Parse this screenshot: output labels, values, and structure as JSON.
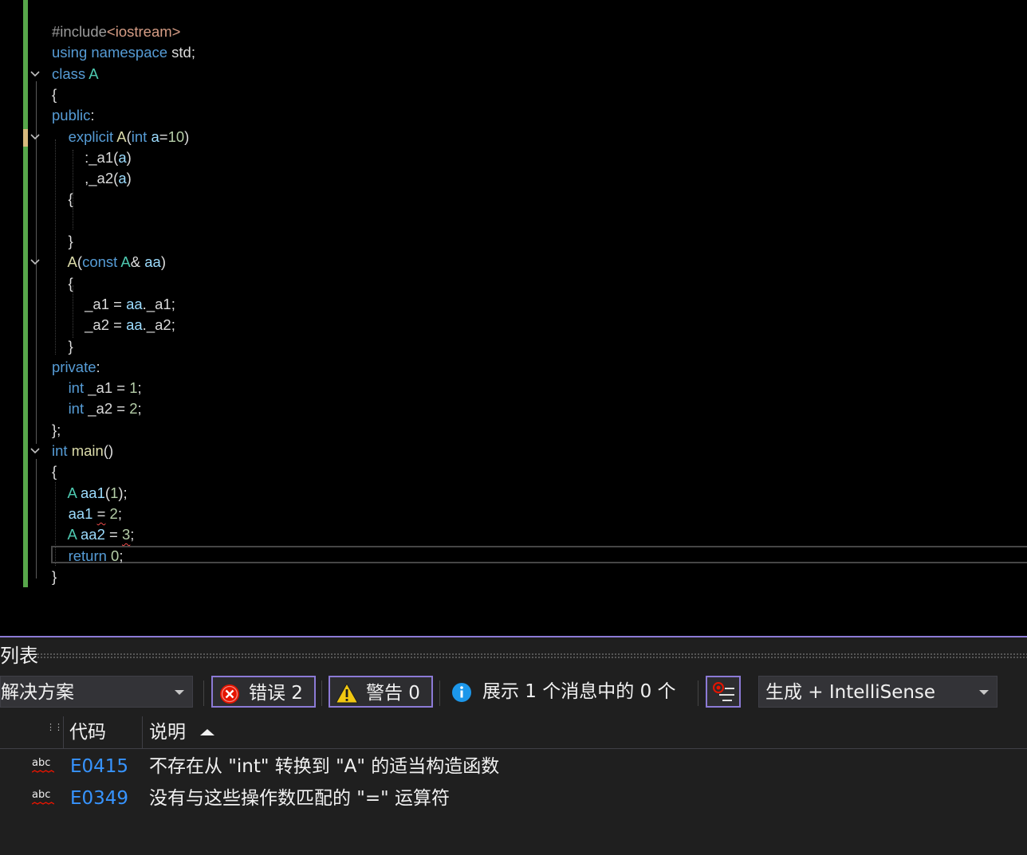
{
  "editor": {
    "lines": [
      [
        [
          "pp",
          "#include"
        ],
        [
          "str",
          "<iostream>"
        ]
      ],
      [
        [
          "kw",
          "using"
        ],
        [
          "t",
          " "
        ],
        [
          "kw",
          "namespace"
        ],
        [
          "t",
          " std;"
        ]
      ],
      [
        [
          "kw",
          "class"
        ],
        [
          "t",
          " "
        ],
        [
          "ty",
          "A"
        ]
      ],
      [
        [
          "t",
          "{"
        ]
      ],
      [
        [
          "kw",
          "public"
        ],
        [
          "t",
          ":"
        ]
      ],
      [
        [
          "t",
          "    "
        ],
        [
          "kw",
          "explicit"
        ],
        [
          "t",
          " "
        ],
        [
          "fn",
          "A"
        ],
        [
          "t",
          "("
        ],
        [
          "kw",
          "int"
        ],
        [
          "t",
          " "
        ],
        [
          "var",
          "a"
        ],
        [
          "t",
          "="
        ],
        [
          "num",
          "10"
        ],
        [
          "t",
          ")"
        ]
      ],
      [
        [
          "t",
          "        :"
        ],
        [
          "mem",
          "_a1"
        ],
        [
          "t",
          "("
        ],
        [
          "var",
          "a"
        ],
        [
          "t",
          ")"
        ]
      ],
      [
        [
          "t",
          "        ,"
        ],
        [
          "mem",
          "_a2"
        ],
        [
          "t",
          "("
        ],
        [
          "var",
          "a"
        ],
        [
          "t",
          ")"
        ]
      ],
      [
        [
          "t",
          "    {"
        ]
      ],
      [
        [
          "t",
          ""
        ]
      ],
      [
        [
          "t",
          "    }"
        ]
      ],
      [
        [
          "t",
          "    "
        ],
        [
          "fn",
          "A"
        ],
        [
          "t",
          "("
        ],
        [
          "kw",
          "const"
        ],
        [
          "t",
          " "
        ],
        [
          "ty",
          "A"
        ],
        [
          "t",
          "& "
        ],
        [
          "var",
          "aa"
        ],
        [
          "t",
          ")"
        ]
      ],
      [
        [
          "t",
          "    {"
        ]
      ],
      [
        [
          "t",
          "        "
        ],
        [
          "mem",
          "_a1"
        ],
        [
          "t",
          " = "
        ],
        [
          "var",
          "aa"
        ],
        [
          "t",
          "."
        ],
        [
          "mem",
          "_a1"
        ],
        [
          "t",
          ";"
        ]
      ],
      [
        [
          "t",
          "        "
        ],
        [
          "mem",
          "_a2"
        ],
        [
          "t",
          " = "
        ],
        [
          "var",
          "aa"
        ],
        [
          "t",
          "."
        ],
        [
          "mem",
          "_a2"
        ],
        [
          "t",
          ";"
        ]
      ],
      [
        [
          "t",
          "    }"
        ]
      ],
      [
        [
          "kw",
          "private"
        ],
        [
          "t",
          ":"
        ]
      ],
      [
        [
          "t",
          "    "
        ],
        [
          "kw",
          "int"
        ],
        [
          "t",
          " "
        ],
        [
          "mem",
          "_a1"
        ],
        [
          "t",
          " = "
        ],
        [
          "num",
          "1"
        ],
        [
          "t",
          ";"
        ]
      ],
      [
        [
          "t",
          "    "
        ],
        [
          "kw",
          "int"
        ],
        [
          "t",
          " "
        ],
        [
          "mem",
          "_a2"
        ],
        [
          "t",
          " = "
        ],
        [
          "num",
          "2"
        ],
        [
          "t",
          ";"
        ]
      ],
      [
        [
          "t",
          "};"
        ]
      ],
      [
        [
          "kw",
          "int"
        ],
        [
          "t",
          " "
        ],
        [
          "fn",
          "main"
        ],
        [
          "t",
          "()"
        ]
      ],
      [
        [
          "t",
          "{"
        ]
      ],
      [
        [
          "t",
          "    "
        ],
        [
          "ty",
          "A"
        ],
        [
          "t",
          " "
        ],
        [
          "var",
          "aa1"
        ],
        [
          "t",
          "("
        ],
        [
          "num",
          "1"
        ],
        [
          "t",
          ");"
        ]
      ],
      [
        [
          "t",
          "    "
        ],
        [
          "var",
          "aa1"
        ],
        [
          "t",
          " "
        ],
        [
          "sq",
          "="
        ],
        [
          "t",
          " "
        ],
        [
          "num",
          "2"
        ],
        [
          "t",
          ";"
        ]
      ],
      [
        [
          "t",
          "    "
        ],
        [
          "ty",
          "A"
        ],
        [
          "t",
          " "
        ],
        [
          "var",
          "aa2"
        ],
        [
          "t",
          " = "
        ],
        [
          "sqn",
          "3"
        ],
        [
          "t",
          ";"
        ]
      ],
      [
        [
          "t",
          "    "
        ],
        [
          "kw",
          "return"
        ],
        [
          "t",
          " "
        ],
        [
          "num",
          "0"
        ],
        [
          "t",
          ";"
        ]
      ],
      [
        [
          "t",
          "}"
        ]
      ]
    ]
  },
  "panel": {
    "title": "列表",
    "scope_value": "解决方案",
    "errors_label": "错误 2",
    "warnings_label": "警告 0",
    "messages_label": "展示 1 个消息中的 0 个",
    "build_filter_value": "生成 + IntelliSense",
    "columns": {
      "code": "代码",
      "description": "说明"
    },
    "rows": [
      {
        "icon": "abc",
        "code": "E0415",
        "description": "不存在从 \"int\" 转换到 \"A\" 的适当构造函数"
      },
      {
        "icon": "abc",
        "code": "E0349",
        "description": "没有与这些操作数匹配的 \"=\" 运算符"
      }
    ]
  },
  "colors": {
    "accent": "#8c7ad6",
    "error": "#e51400",
    "warning": "#f2c811",
    "info": "#1c97ea",
    "code_link": "#3794ff",
    "change_bar": "#57a64a"
  }
}
